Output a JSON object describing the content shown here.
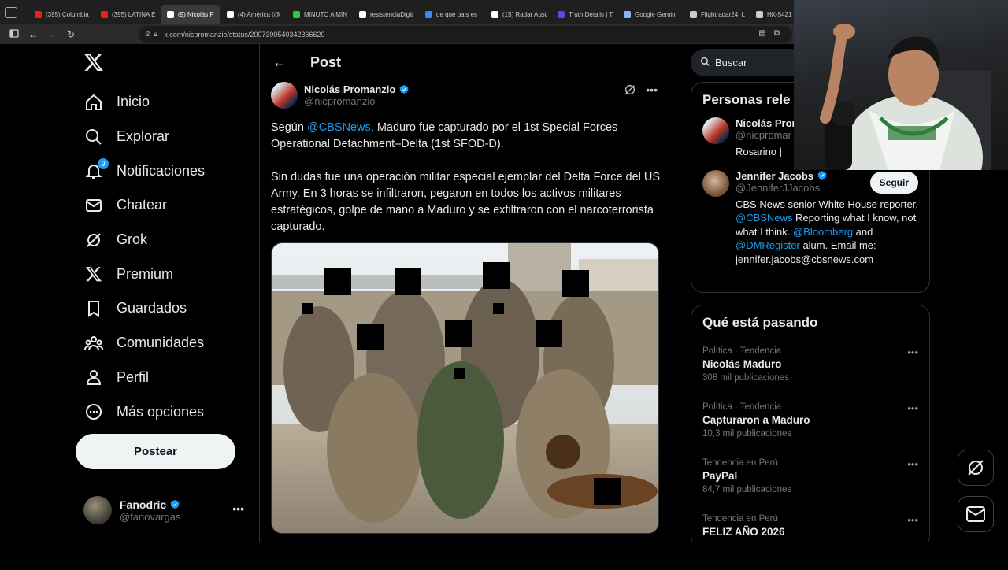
{
  "browser": {
    "tabs": [
      {
        "label": "(395) Columbia",
        "color": "#e62117",
        "active": false
      },
      {
        "label": "(395) LATINA E",
        "color": "#e62117",
        "active": false
      },
      {
        "label": "(9) Nicolás P",
        "color": "#ffffff",
        "active": true
      },
      {
        "label": "(4) América (@",
        "color": "#ffffff",
        "active": false
      },
      {
        "label": "MINUTO A MIN",
        "color": "#2ecc40",
        "active": false
      },
      {
        "label": "resistenciaDigit",
        "color": "#ffffff",
        "active": false
      },
      {
        "label": "de que pais es",
        "color": "#4285f4",
        "active": false
      },
      {
        "label": "(15) Radar Aust",
        "color": "#ffffff",
        "active": false
      },
      {
        "label": "Truth Details | T",
        "color": "#5448ee",
        "active": false
      },
      {
        "label": "Google Gemini",
        "color": "#8ab4f8",
        "active": false
      },
      {
        "label": "Flightradar24: L",
        "color": "#cccccc",
        "active": false
      },
      {
        "label": "HK-5421 | Ai",
        "color": "#cccccc",
        "active": false
      }
    ],
    "url": "x.com/nicpromanzio/status/2007390540342366620"
  },
  "sidebar": {
    "nav": [
      {
        "label": "Inicio",
        "icon": "home-icon"
      },
      {
        "label": "Explorar",
        "icon": "search-icon"
      },
      {
        "label": "Notificaciones",
        "icon": "bell-icon",
        "badge": "9"
      },
      {
        "label": "Chatear",
        "icon": "mail-icon"
      },
      {
        "label": "Grok",
        "icon": "grok-icon"
      },
      {
        "label": "Premium",
        "icon": "x-icon"
      },
      {
        "label": "Guardados",
        "icon": "bookmark-icon"
      },
      {
        "label": "Comunidades",
        "icon": "communities-icon"
      },
      {
        "label": "Perfil",
        "icon": "person-icon"
      },
      {
        "label": "Más opciones",
        "icon": "more-circle-icon"
      }
    ],
    "post_button": "Postear",
    "account": {
      "name": "Fanodric",
      "handle": "@fanovargas"
    }
  },
  "main": {
    "header_title": "Post",
    "author": {
      "name": "Nicolás Promanzio",
      "handle": "@nicpromanzio"
    },
    "tweet": {
      "p1_pre": "Según ",
      "p1_mention": "@CBSNews",
      "p1_post": ", Maduro fue capturado por el 1st Special Forces Operational Detachment–Delta (1st SFOD-D).",
      "p2": "Sin dudas fue una operación militar especial ejemplar del Delta Force del US Army. En 3 horas se infiltraron, pegaron en todos los activos militares estratégicos, golpe de mano a Maduro y se exfiltraron con el narcoterrorista capturado."
    }
  },
  "right": {
    "search_placeholder": "Buscar",
    "relevant_title": "Personas rele",
    "people": [
      {
        "name": "Nicolás Prom",
        "handle": "@nicpromar",
        "bio": "Rosarino |"
      },
      {
        "name": "Jennifer Jacobs",
        "handle": "@JenniferJJacobs",
        "follow": "Seguir",
        "bio_1": "CBS News senior White House reporter. ",
        "bio_m1": "@CBSNews",
        "bio_2": " Reporting what I know, not what I think. ",
        "bio_m2": "@Bloomberg",
        "bio_3": " and ",
        "bio_m3": "@DMRegister",
        "bio_4": " alum. Email me: jennifer.jacobs@cbsnews.com"
      }
    ],
    "trends_title": "Qué está pasando",
    "trends": [
      {
        "context": "Política · Tendencia",
        "name": "Nicolás Maduro",
        "count": "308 mil publicaciones"
      },
      {
        "context": "Política · Tendencia",
        "name": "Capturaron a Maduro",
        "count": "10,3 mil publicaciones"
      },
      {
        "context": "Tendencia en Perú",
        "name": "PayPal",
        "count": "84,7 mil publicaciones"
      },
      {
        "context": "Tendencia en Perú",
        "name": "FELIZ AÑO 2026",
        "count": ""
      }
    ]
  },
  "colors": {
    "accent": "#1d9bf0",
    "background": "#000000"
  }
}
